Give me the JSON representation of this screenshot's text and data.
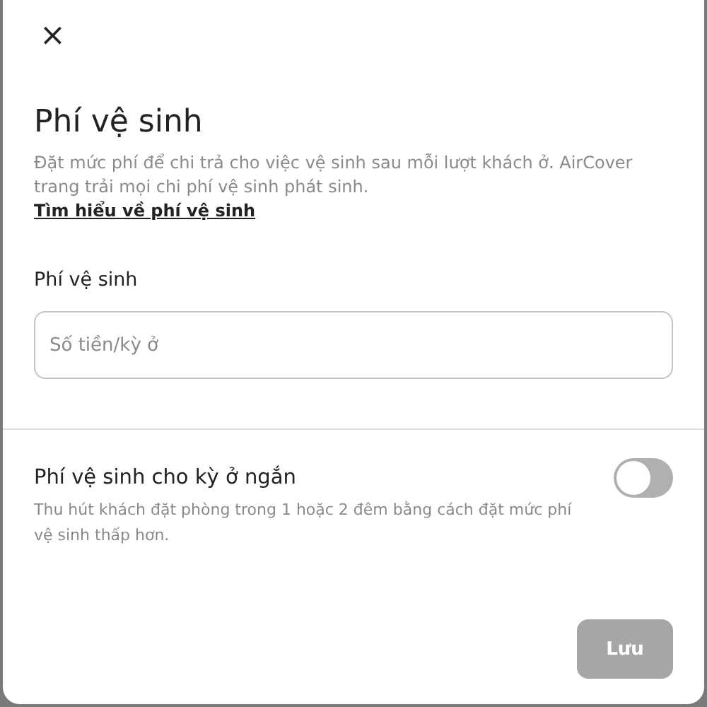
{
  "dialog": {
    "close": "×",
    "title": "Phí vệ sinh",
    "description": "Đặt mức phí để chi trả cho việc vệ sinh sau mỗi lượt khách ở. AirCover trang trải mọi chi phí vệ sinh phát sinh.",
    "link": "Tìm hiểu về phí vệ sinh"
  },
  "fee_field": {
    "label": "Phí vệ sinh",
    "placeholder": "Số tiền/kỳ ở"
  },
  "short_stay": {
    "title": "Phí vệ sinh cho kỳ ở ngắn",
    "description": "Thu hút khách đặt phòng trong 1 hoặc 2 đêm bằng cách đặt mức phí vệ sinh thấp hơn.",
    "on": false
  },
  "save_button": {
    "label": "Lưu",
    "disabled": true
  }
}
